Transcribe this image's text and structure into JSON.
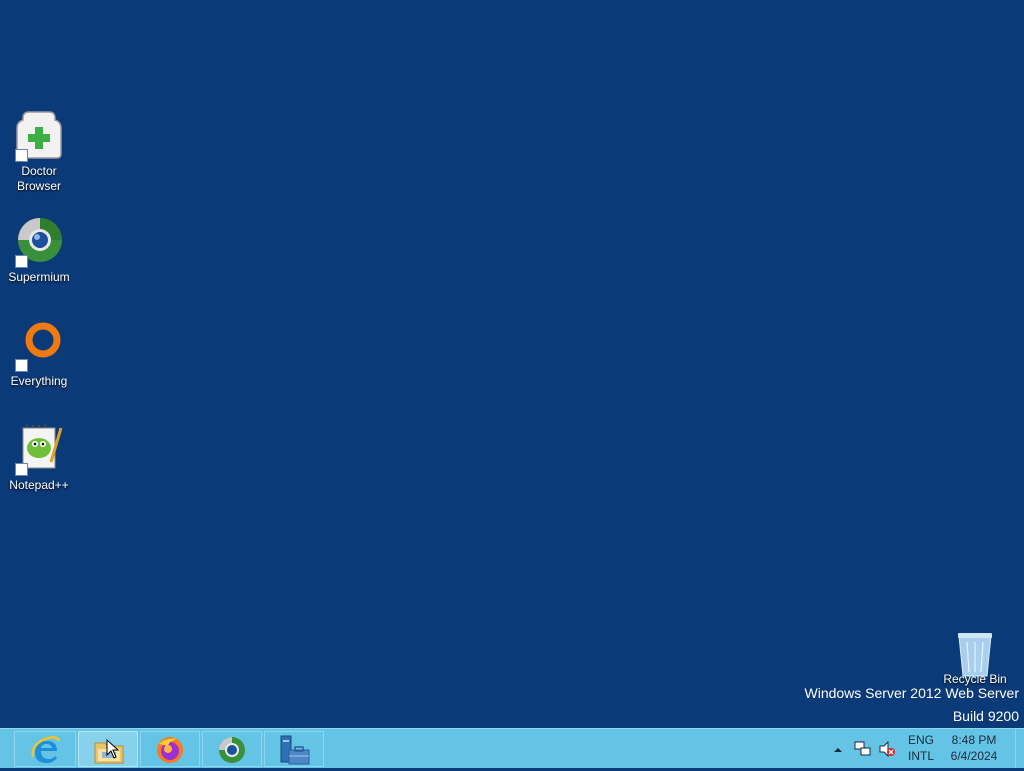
{
  "desktop": {
    "icons": [
      {
        "label_line1": "Doctor",
        "label_line2": "Browser",
        "icon": "doctor-browser-icon"
      },
      {
        "label": "Supermium",
        "icon": "supermium-icon"
      },
      {
        "label": "Everything",
        "icon": "everything-icon"
      },
      {
        "label": "Notepad++",
        "icon": "notepadpp-icon"
      },
      {
        "label": "Recycle Bin",
        "icon": "recycle-bin-icon"
      }
    ],
    "watermark": {
      "line1": "Windows Server 2012 Web Server",
      "line2": "Build 9200"
    }
  },
  "taskbar": {
    "buttons": [
      {
        "name": "internet-explorer",
        "icon": "internet-explorer-icon"
      },
      {
        "name": "file-explorer",
        "icon": "folder-icon"
      },
      {
        "name": "firefox",
        "icon": "firefox-icon"
      },
      {
        "name": "supermium",
        "icon": "supermium-icon"
      },
      {
        "name": "server-manager",
        "icon": "server-manager-icon"
      }
    ],
    "tray": {
      "lang_top": "ENG",
      "lang_bottom": "INTL",
      "time": "8:48 PM",
      "date": "6/4/2024"
    }
  },
  "colors": {
    "desktop": "#0b3a78",
    "taskbar": "#64c4e6"
  }
}
